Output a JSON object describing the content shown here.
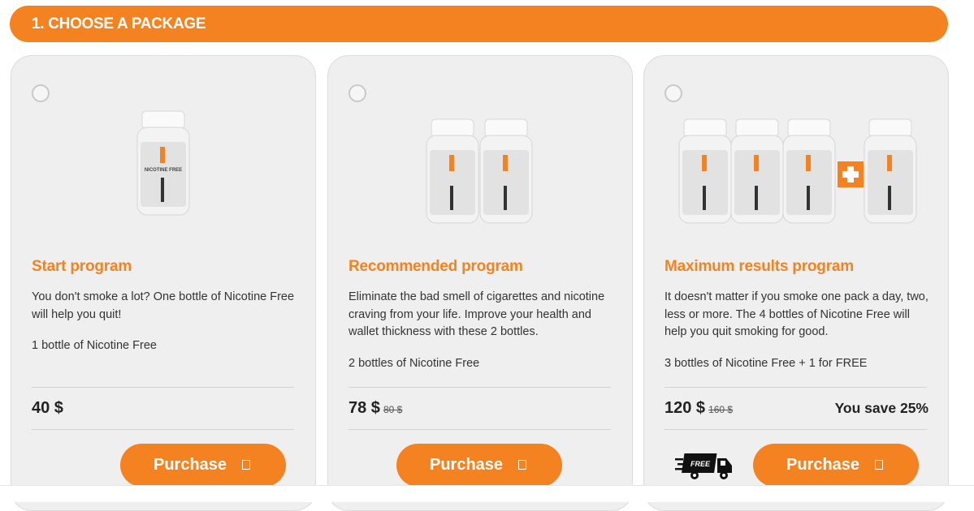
{
  "header": {
    "title": "1. CHOOSE A PACKAGE"
  },
  "packages": [
    {
      "title": "Start program",
      "description": "You don't smoke a lot? One bottle of Nicotine Free will help you quit!",
      "quantity": "1 bottle of Nicotine Free",
      "price": "40 $",
      "old_price": "",
      "save": "",
      "button": "Purchase",
      "bottles": 1
    },
    {
      "title": "Recommended program",
      "description": "Eliminate the bad smell of cigarettes and nicotine craving from your life. Improve your health and wallet thickness with these 2 bottles.",
      "quantity": "2 bottles of Nicotine Free",
      "price": "78 $",
      "old_price": "80 $",
      "save": "",
      "button": "Purchase",
      "bottles": 2
    },
    {
      "title": "Maximum results program",
      "description": "It doesn't matter if you smoke one pack a day, two, less or more. The 4 bottles of Nicotine Free will help you quit smoking for good.",
      "quantity": "3 bottles of Nicotine Free + 1 for FREE",
      "price": "120 $",
      "old_price": "160 $",
      "save": "You save 25%",
      "button": "Purchase",
      "bottles": 3,
      "free_bottles": 1,
      "free_badge": "FREE"
    }
  ],
  "product_label": "NICOTINE FREE",
  "colors": {
    "accent": "#f58220",
    "card_bg": "#efefef"
  }
}
